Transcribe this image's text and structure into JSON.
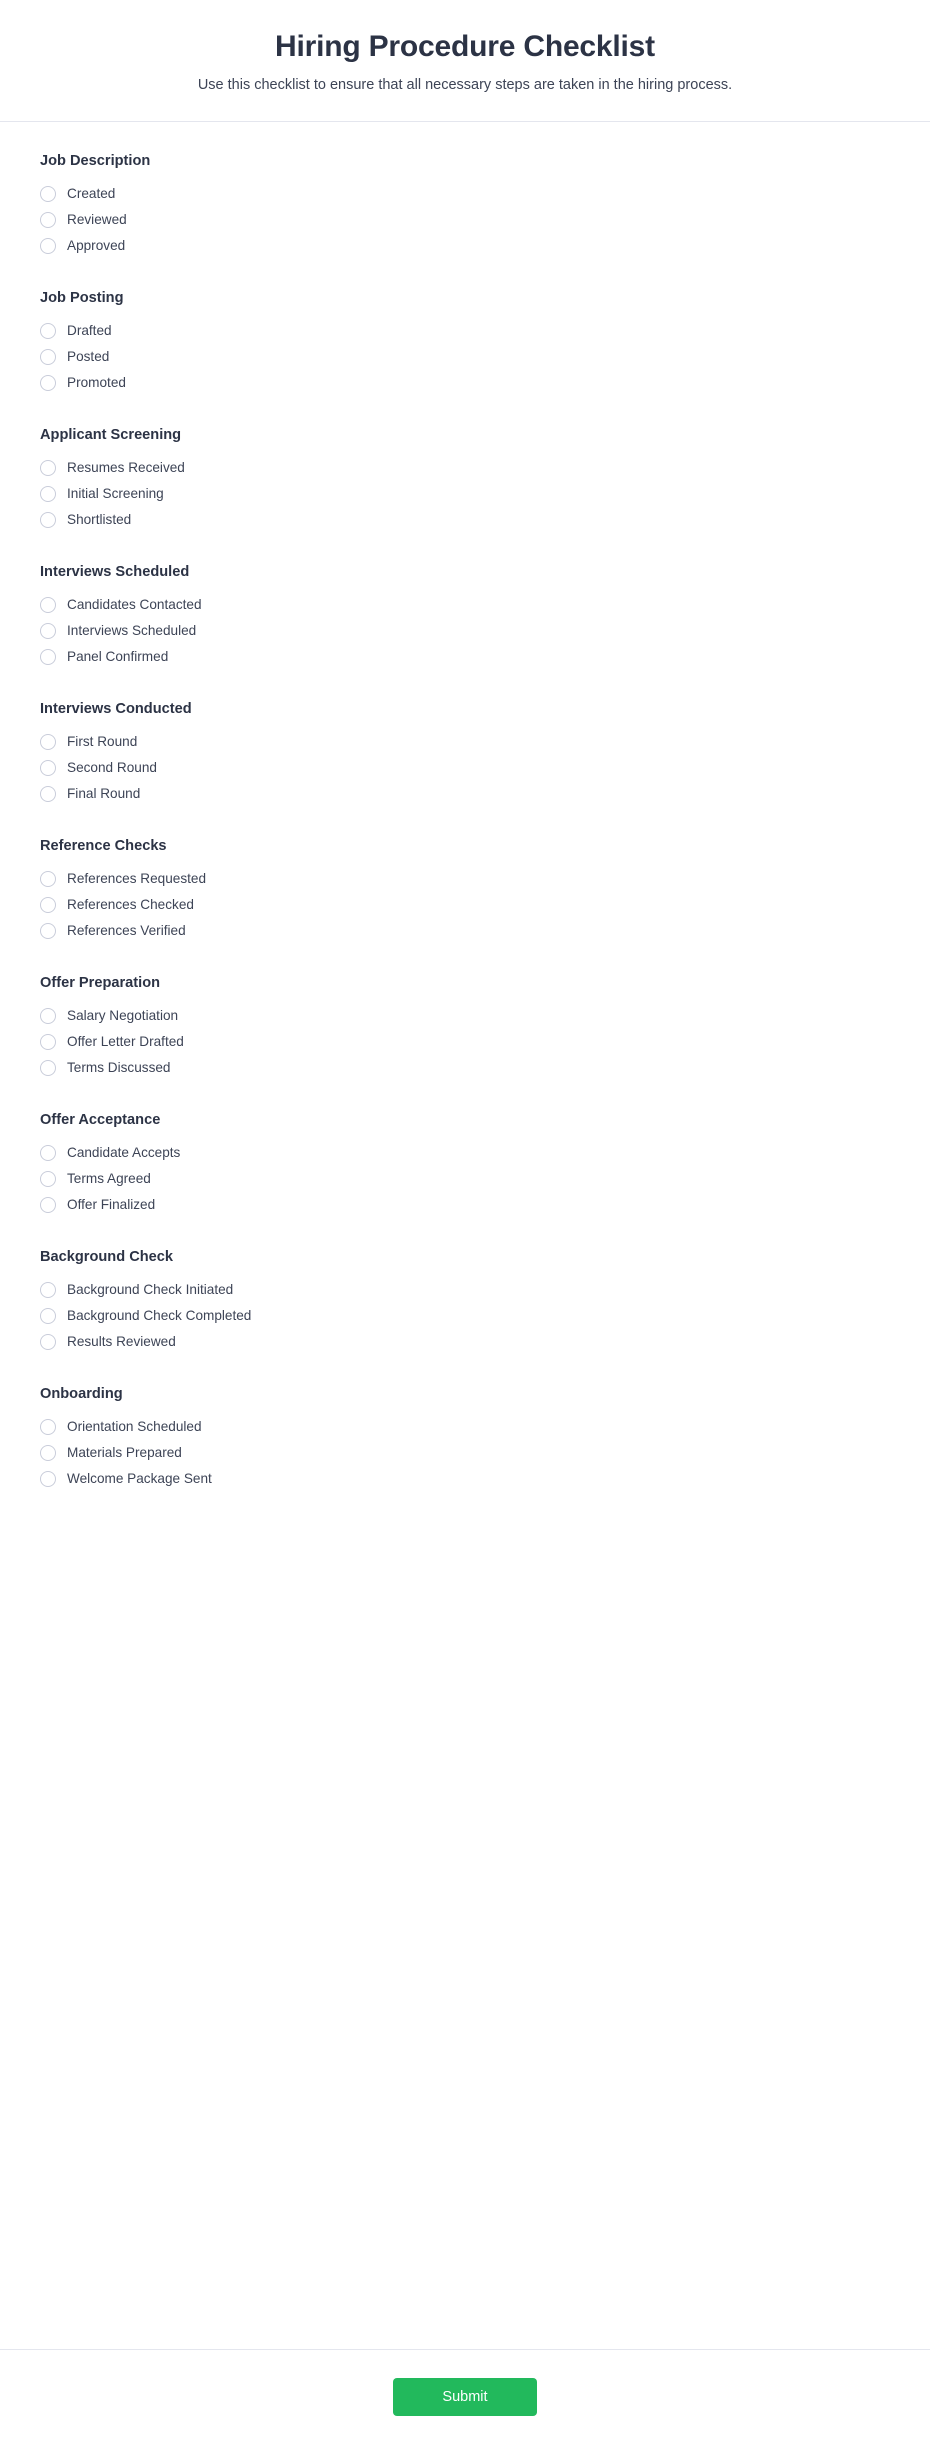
{
  "header": {
    "title": "Hiring Procedure Checklist",
    "subtitle": "Use this checklist to ensure that all necessary steps are taken in the hiring process."
  },
  "colors": {
    "submit_green": "#22b95c",
    "text_dark": "#2c3345",
    "text_body": "#3d4456",
    "divider": "#e4e6ee",
    "radio_border": "#c9cdda"
  },
  "sections": [
    {
      "title": "Job Description",
      "options": [
        {
          "label": "Created",
          "selected": false
        },
        {
          "label": "Reviewed",
          "selected": false
        },
        {
          "label": "Approved",
          "selected": false
        }
      ]
    },
    {
      "title": "Job Posting",
      "options": [
        {
          "label": "Drafted",
          "selected": false
        },
        {
          "label": "Posted",
          "selected": false
        },
        {
          "label": "Promoted",
          "selected": false
        }
      ]
    },
    {
      "title": "Applicant Screening",
      "options": [
        {
          "label": "Resumes Received",
          "selected": false
        },
        {
          "label": "Initial Screening",
          "selected": false
        },
        {
          "label": "Shortlisted",
          "selected": false
        }
      ]
    },
    {
      "title": "Interviews Scheduled",
      "options": [
        {
          "label": "Candidates Contacted",
          "selected": false
        },
        {
          "label": "Interviews Scheduled",
          "selected": false
        },
        {
          "label": "Panel Confirmed",
          "selected": false
        }
      ]
    },
    {
      "title": "Interviews Conducted",
      "options": [
        {
          "label": "First Round",
          "selected": false
        },
        {
          "label": "Second Round",
          "selected": false
        },
        {
          "label": "Final Round",
          "selected": false
        }
      ]
    },
    {
      "title": "Reference Checks",
      "options": [
        {
          "label": "References Requested",
          "selected": false
        },
        {
          "label": "References Checked",
          "selected": false
        },
        {
          "label": "References Verified",
          "selected": false
        }
      ]
    },
    {
      "title": "Offer Preparation",
      "options": [
        {
          "label": "Salary Negotiation",
          "selected": false
        },
        {
          "label": "Offer Letter Drafted",
          "selected": false
        },
        {
          "label": "Terms Discussed",
          "selected": false
        }
      ]
    },
    {
      "title": "Offer Acceptance",
      "options": [
        {
          "label": "Candidate Accepts",
          "selected": false
        },
        {
          "label": "Terms Agreed",
          "selected": false
        },
        {
          "label": "Offer Finalized",
          "selected": false
        }
      ]
    },
    {
      "title": "Background Check",
      "options": [
        {
          "label": "Background Check Initiated",
          "selected": false
        },
        {
          "label": "Background Check Completed",
          "selected": false
        },
        {
          "label": "Results Reviewed",
          "selected": false
        }
      ]
    },
    {
      "title": "Onboarding",
      "options": [
        {
          "label": "Orientation Scheduled",
          "selected": false
        },
        {
          "label": "Materials Prepared",
          "selected": false
        },
        {
          "label": "Welcome Package Sent",
          "selected": false
        }
      ]
    }
  ],
  "footer": {
    "submit_label": "Submit"
  }
}
